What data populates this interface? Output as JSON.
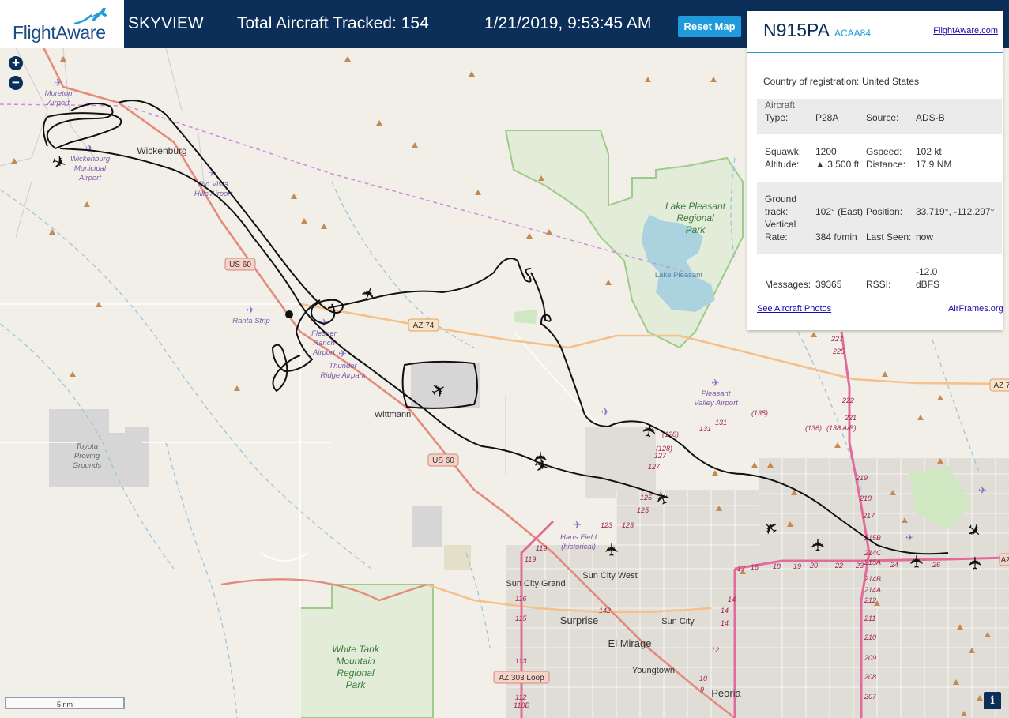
{
  "header": {
    "logo_text": "FlightAware",
    "title": "SKYVIEW",
    "total_tracked": "Total Aircraft Tracked: 154",
    "datetime": "1/21/2019, 9:53:45 AM",
    "reset_label": "Reset Map"
  },
  "panel": {
    "registration": "N915PA",
    "ident": "ACAA84",
    "fa_link": "FlightAware.com",
    "country_label": "Country of registration:",
    "country_value": "United States",
    "aircraft_type_label_1": "Aircraft",
    "aircraft_type_label_2": "Type:",
    "aircraft_type_value": "P28A",
    "source_label": "Source:",
    "source_value": "ADS-B",
    "squawk_label": "Squawk:",
    "squawk_value": "1200",
    "gspeed_label": "Gspeed:",
    "gspeed_value": "102 kt",
    "altitude_label": "Altitude:",
    "altitude_value": "▲ 3,500 ft",
    "distance_label": "Distance:",
    "distance_value": "17.9 NM",
    "ground_label_1": "Ground",
    "ground_label_2": "track:",
    "ground_value": "102° (East)",
    "position_label": "Position:",
    "position_value": "33.719°, -112.297°",
    "vrate_label_1": "Vertical",
    "vrate_label_2": "Rate:",
    "vrate_value": "384 ft/min",
    "lastseen_label": "Last Seen:",
    "lastseen_value": "now",
    "messages_label": "Messages:",
    "messages_value": "39365",
    "rssi_label": "RSSI:",
    "rssi_value_1": "-12.0",
    "rssi_value_2": "dBFS",
    "photos_link": "See Aircraft Photos",
    "airframes_link": "AirFrames.org"
  },
  "map": {
    "zoom_in": "+",
    "zoom_out": "−",
    "scale_label": "5 nm",
    "info_label": "i",
    "places": {
      "moreton": [
        "Moreton",
        "Airport"
      ],
      "wickenburg": "Wickenburg",
      "wick_muni": [
        "Wickenburg",
        "Municipal",
        "Airport"
      ],
      "rio_vista": [
        "Rio Vista",
        "Hills Airport"
      ],
      "ranta": "Ranta Strip",
      "flesner": [
        "Flesner",
        "Ranch",
        "Airport"
      ],
      "thunder": [
        "Thunder",
        "Ridge Airpark"
      ],
      "wittmann": "Wittmann",
      "toyota": [
        "Toyota",
        "Proving",
        "Grounds"
      ],
      "lake_park": [
        "Lake Pleasant",
        "Regional",
        "Park"
      ],
      "lake": "Lake Pleasant",
      "pleasant_valley": [
        "Pleasant",
        "Valley Airport"
      ],
      "harts": [
        "Harts Field",
        "(historical)"
      ],
      "sun_city_west": "Sun City West",
      "sun_city_grand": "Sun City Grand",
      "surprise": "Surprise",
      "el_mirage": "El Mirage",
      "sun_city": "Sun City",
      "youngtown": "Youngtown",
      "peoria": "Peoria",
      "white_tank": [
        "White Tank",
        "Mountain",
        "Regional",
        "Park"
      ]
    },
    "shields": {
      "us60_a": "US 60",
      "us60_b": "US 60",
      "az74": "AZ 74",
      "az303": "AZ 303 Loop",
      "az7": "AZ 7",
      "az_r": "AZ"
    },
    "exits_101": [
      "227",
      "225",
      "222",
      "221",
      "219",
      "218",
      "217",
      "215B",
      "214C",
      "215A",
      "214B",
      "214A",
      "212",
      "211",
      "210",
      "209",
      "208",
      "207"
    ],
    "exits_303": [
      "119",
      "119",
      "116",
      "115",
      "113",
      "112",
      "110B"
    ],
    "exits_misc": [
      "(135)",
      "(136)",
      "(138 A/B)",
      "131",
      "131",
      "(128)",
      "(128)",
      "127",
      "127",
      "125",
      "125",
      "123",
      "123",
      "142",
      "17",
      "16",
      "18",
      "19",
      "20",
      "22",
      "23",
      "24",
      "26",
      "14",
      "14",
      "14",
      "12",
      "10",
      "9"
    ]
  }
}
